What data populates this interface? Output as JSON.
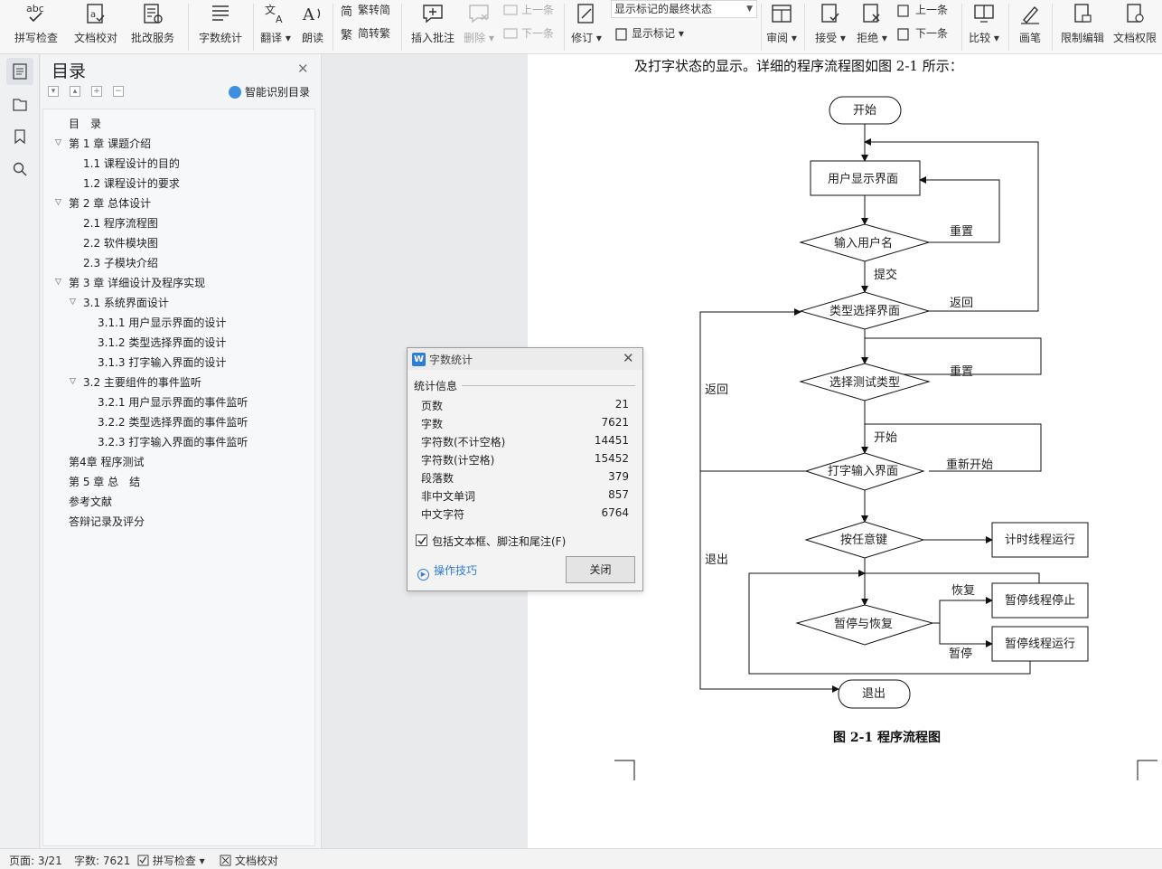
{
  "ribbon": {
    "spell_check": "拼写检查",
    "doc_proof": "文档校对",
    "review_service": "批改服务",
    "word_count": "字数统计",
    "translate": "翻译",
    "read_aloud": "朗读",
    "trad_to_simp": "繁转简",
    "simp_to_trad": "简转繁",
    "insert_comment": "插入批注",
    "delete": "删除",
    "prev_comment": "上一条",
    "next_comment": "下一条",
    "revise": "修订",
    "markup_state": "显示标记的最终状态",
    "show_markup": "显示标记",
    "review": "审阅",
    "accept": "接受",
    "reject": "拒绝",
    "prev_change": "上一条",
    "next_change": "下一条",
    "compare": "比较",
    "ink": "画笔",
    "restrict_edit": "限制编辑",
    "doc_permission": "文档权限"
  },
  "toc": {
    "title": "目录",
    "smart_toc": "智能识别目录",
    "items": [
      {
        "label": "目　录",
        "level": 0
      },
      {
        "label": "第 1 章  课题介绍",
        "level": 1
      },
      {
        "label": "1.1  课程设计的目的",
        "level": 2
      },
      {
        "label": "1.2  课程设计的要求",
        "level": 2
      },
      {
        "label": "第 2 章  总体设计",
        "level": 1
      },
      {
        "label": "2.1  程序流程图",
        "level": 2
      },
      {
        "label": "2.2  软件模块图",
        "level": 2
      },
      {
        "label": "2.3  子模块介绍",
        "level": 2
      },
      {
        "label": "第 3 章  详细设计及程序实现",
        "level": 1
      },
      {
        "label": "3.1  系统界面设计",
        "level": 2
      },
      {
        "label": "3.1.1  用户显示界面的设计",
        "level": 3
      },
      {
        "label": "3.1.2 类型选择界面的设计",
        "level": 3
      },
      {
        "label": "3.1.3  打字输入界面的设计",
        "level": 3
      },
      {
        "label": "3.2  主要组件的事件监听",
        "level": 2
      },
      {
        "label": "3.2.1  用户显示界面的事件监听",
        "level": 3
      },
      {
        "label": "3.2.2  类型选择界面的事件监听",
        "level": 3
      },
      {
        "label": "3.2.3  打字输入界面的事件监听",
        "level": 3
      },
      {
        "label": "第4章  程序测试",
        "level": 1
      },
      {
        "label": "第 5 章  总　结",
        "level": 1
      },
      {
        "label": "参考文献",
        "level": 1
      },
      {
        "label": "答辩记录及评分",
        "level": 1
      }
    ]
  },
  "document": {
    "intro_text": "及打字状态的显示。详细的程序流程图如图 2-1 所示：",
    "figure_caption": "图 2-1  程序流程图",
    "flow": {
      "start": "开始",
      "user_display": "用户显示界面",
      "input_username": "输入用户名",
      "reset1": "重置",
      "submit": "提交",
      "type_select": "类型选择界面",
      "back1": "返回",
      "back2": "返回",
      "select_test_type": "选择测试类型",
      "reset2": "重置",
      "begin": "开始",
      "typing_input": "打字输入界面",
      "restart": "重新开始",
      "press_any_key": "按任意键",
      "timer_running": "计时线程运行",
      "exit_label": "退出",
      "pause_resume": "暂停与恢复",
      "resume": "恢复",
      "pause": "暂停",
      "thread_stop": "暂停线程停止",
      "thread_run": "暂停线程运行",
      "exit": "退出"
    }
  },
  "dialog": {
    "title": "字数统计",
    "section": "统计信息",
    "stats": [
      {
        "label": "页数",
        "value": "21"
      },
      {
        "label": "字数",
        "value": "7621"
      },
      {
        "label": "字符数(不计空格)",
        "value": "14451"
      },
      {
        "label": "字符数(计空格)",
        "value": "15452"
      },
      {
        "label": "段落数",
        "value": "379"
      },
      {
        "label": "非中文单词",
        "value": "857"
      },
      {
        "label": "中文字符",
        "value": "6764"
      }
    ],
    "checkbox_label": "包括文本框、脚注和尾注(F)",
    "tips": "操作技巧",
    "close": "关闭"
  },
  "status": {
    "page": "页面: 3/21",
    "words": "字数: 7621",
    "spell_check": "拼写检查",
    "doc_proof": "文档校对"
  },
  "colors": {
    "accent": "#2f7cd4",
    "ribbon_bg": "#f7f7f7",
    "panel_bg": "#f3f4f5"
  }
}
